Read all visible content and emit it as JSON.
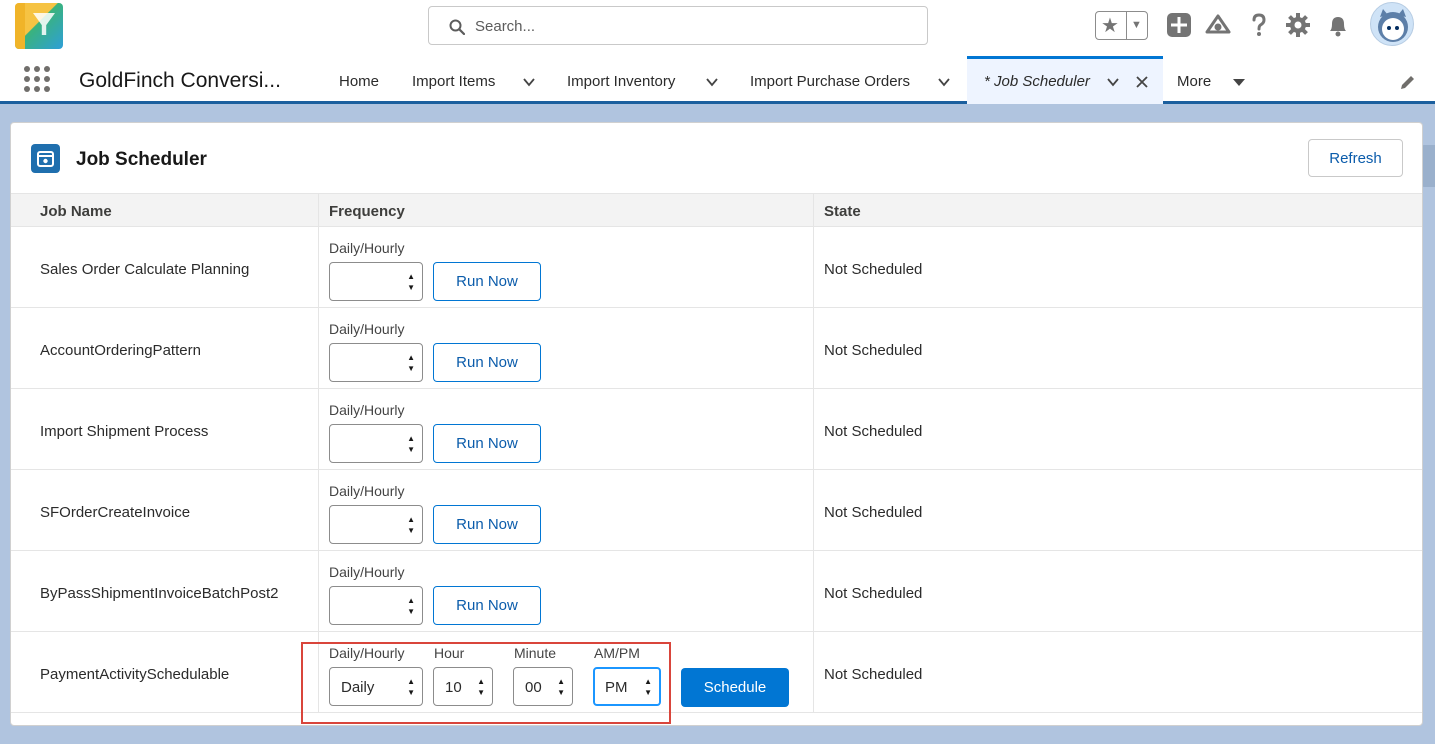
{
  "header": {
    "search_placeholder": "Search...",
    "icons": [
      "favorites-star-icon",
      "add-icon",
      "trailhead-icon",
      "help-icon",
      "setup-gear-icon",
      "notifications-bell-icon",
      "user-avatar"
    ]
  },
  "nav": {
    "app_name": "GoldFinch Conversi...",
    "items": [
      {
        "label": "Home"
      },
      {
        "label": "Import Items"
      },
      {
        "label": "Import Inventory"
      },
      {
        "label": "Import Purchase Orders"
      },
      {
        "label": "* Job Scheduler"
      },
      {
        "label": "More"
      }
    ]
  },
  "card": {
    "title": "Job Scheduler",
    "refresh_label": "Refresh",
    "columns": {
      "job_name": "Job Name",
      "frequency": "Frequency",
      "state": "State"
    },
    "rows": [
      {
        "job": "Sales Order Calculate Planning",
        "freq_label": "Daily/Hourly",
        "freq_value": "",
        "action": "Run Now",
        "state": "Not Scheduled"
      },
      {
        "job": "AccountOrderingPattern",
        "freq_label": "Daily/Hourly",
        "freq_value": "",
        "action": "Run Now",
        "state": "Not Scheduled"
      },
      {
        "job": "Import Shipment Process",
        "freq_label": "Daily/Hourly",
        "freq_value": "",
        "action": "Run Now",
        "state": "Not Scheduled"
      },
      {
        "job": "SFOrderCreateInvoice",
        "freq_label": "Daily/Hourly",
        "freq_value": "",
        "action": "Run Now",
        "state": "Not Scheduled"
      },
      {
        "job": "ByPassShipmentInvoiceBatchPost2",
        "freq_label": "Daily/Hourly",
        "freq_value": "",
        "action": "Run Now",
        "state": "Not Scheduled"
      },
      {
        "job": "PaymentActivitySchedulable",
        "freq_label": "Daily/Hourly",
        "freq_value": "Daily",
        "hour_label": "Hour",
        "hour_value": "10",
        "minute_label": "Minute",
        "minute_value": "00",
        "ampm_label": "AM/PM",
        "ampm_value": "PM",
        "action": "Schedule",
        "state": "Not Scheduled"
      }
    ]
  },
  "colors": {
    "brand": "#0176d3",
    "highlight": "#d9453b",
    "background": "#b0c4df"
  }
}
